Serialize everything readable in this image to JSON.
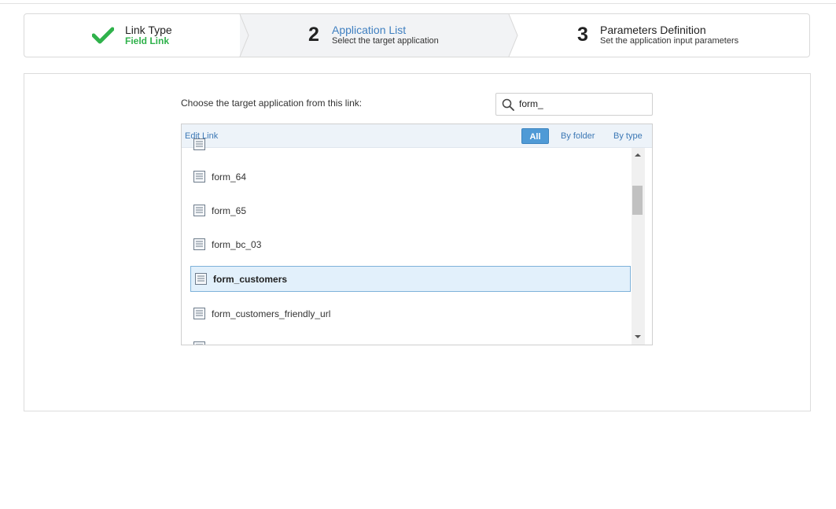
{
  "wizard": {
    "step1": {
      "title": "Link Type",
      "subtitle": "Field Link",
      "icon": "check-icon",
      "status": "done"
    },
    "step2": {
      "number": "2",
      "title": "Application List",
      "subtitle": "Select the target application",
      "status": "active"
    },
    "step3": {
      "number": "3",
      "title": "Parameters Definition",
      "subtitle": "Set the application input parameters",
      "status": "pending"
    }
  },
  "main": {
    "choose_label": "Choose the target application from this link:",
    "search": {
      "value": "form_",
      "icon": "search-icon"
    },
    "list": {
      "edit_link": "Edit Link",
      "filters": {
        "all": "All",
        "by_folder": "By folder",
        "by_type": "By type",
        "selected": "All"
      },
      "items": [
        {
          "label": "form_64",
          "icon": "form-icon",
          "selected": false
        },
        {
          "label": "form_65",
          "icon": "form-icon",
          "selected": false
        },
        {
          "label": "form_bc_03",
          "icon": "form-icon",
          "selected": false
        },
        {
          "label": "form_customers",
          "icon": "form-icon",
          "selected": true
        },
        {
          "label": "form_customers_friendly_url",
          "icon": "form-icon",
          "selected": false
        }
      ]
    }
  },
  "colors": {
    "accent": "#3f7fc0",
    "success": "#2fb24b",
    "selected_bg": "#e2f0fb",
    "filter_active": "#4f9ad6"
  }
}
